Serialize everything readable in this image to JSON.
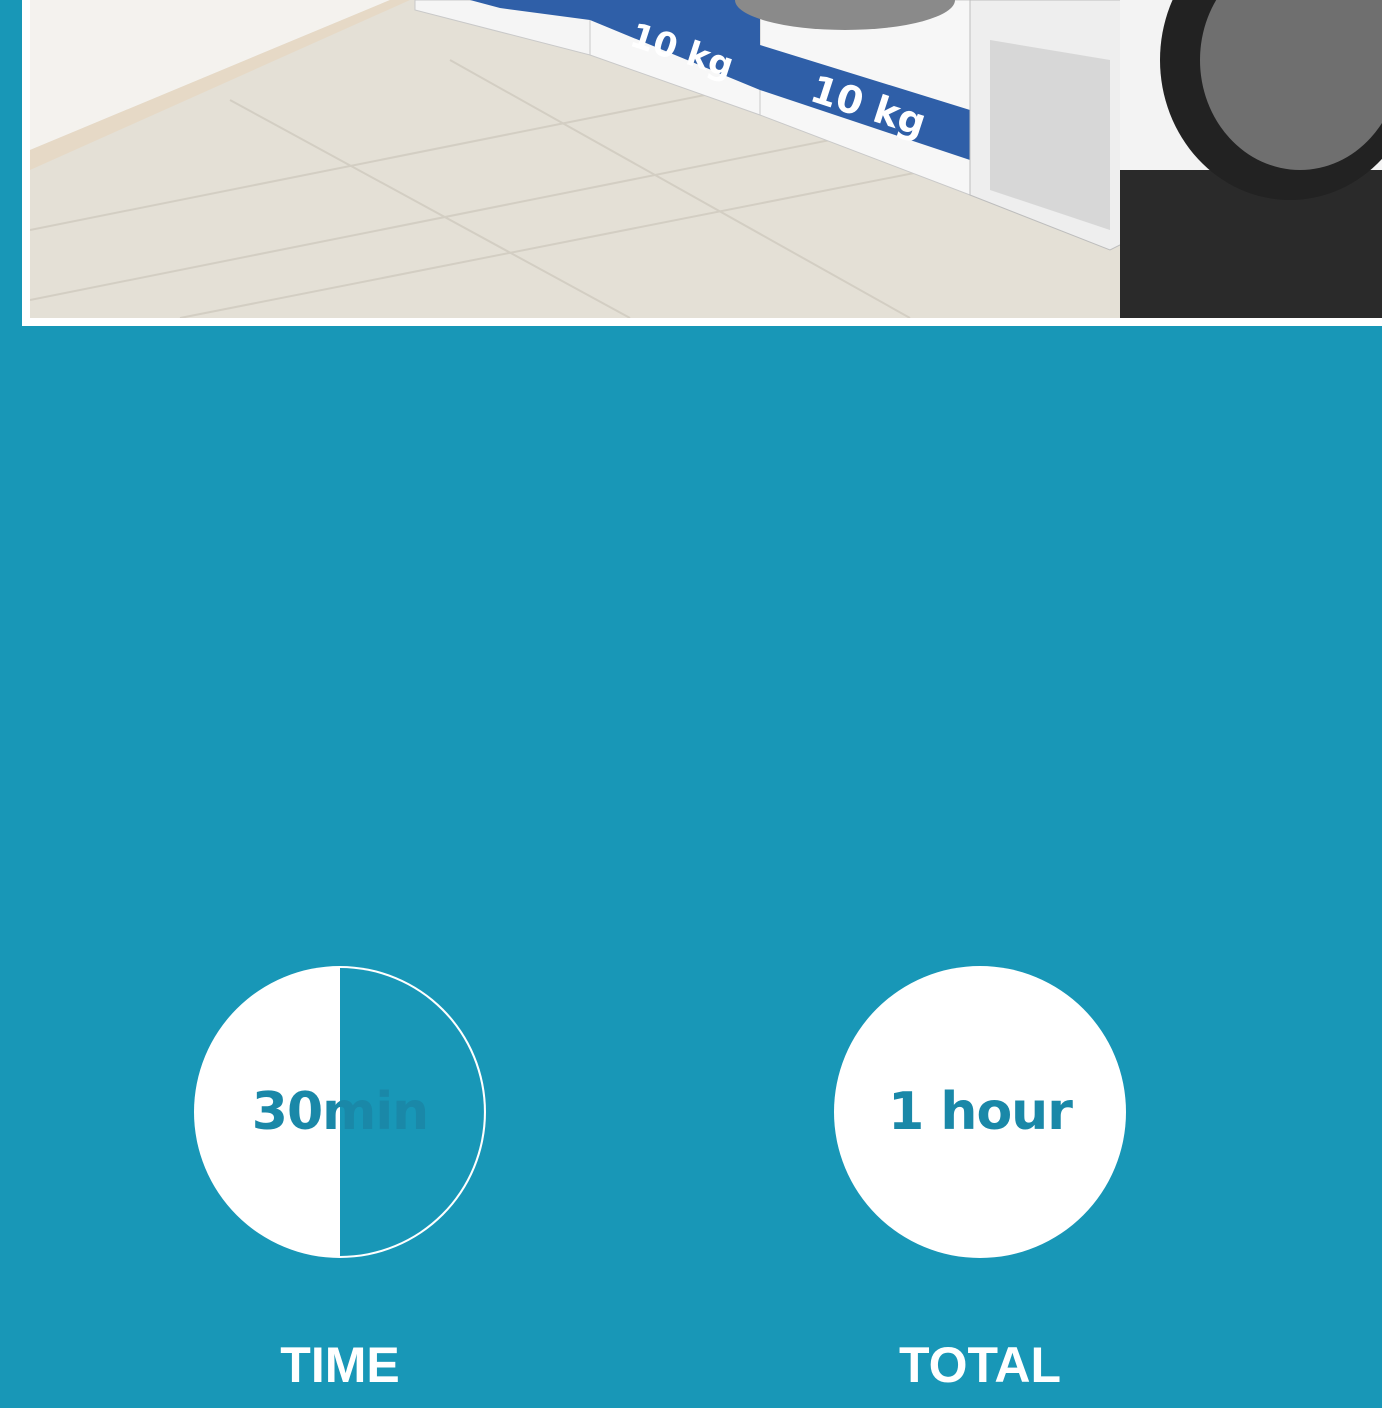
{
  "colors": {
    "background": "#1897b7",
    "circle": "#ffffff",
    "value_text": "#1a88a8",
    "label_text": "#ffffff",
    "stripe_blue": "#2f5fa8"
  },
  "photo": {
    "scale_labels": [
      "10 kg",
      "10 kg"
    ]
  },
  "stats": [
    {
      "value": "30min",
      "label": "TIME",
      "fill_fraction": 0.5
    },
    {
      "value": "1 hour",
      "label": "TOTAL",
      "fill_fraction": 1.0
    }
  ]
}
